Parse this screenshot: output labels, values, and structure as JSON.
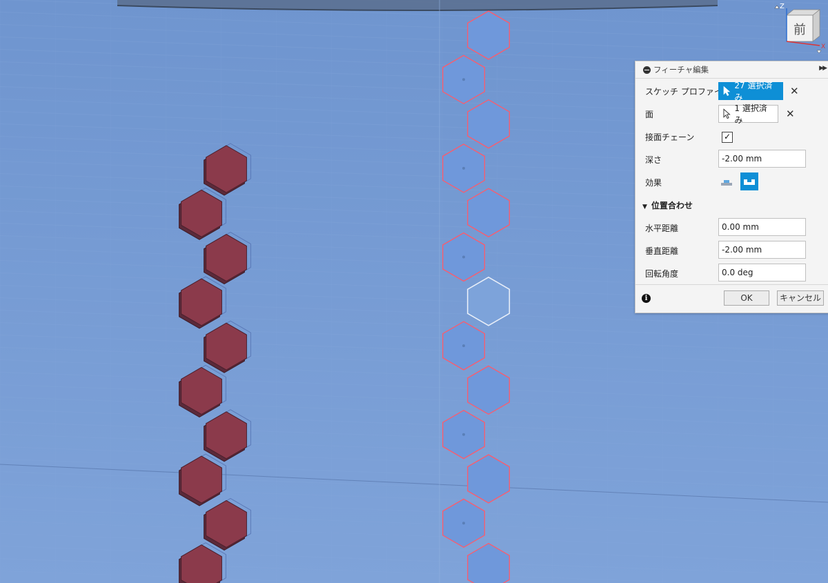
{
  "viewcube": {
    "face_label": "前",
    "axis_z": "Z",
    "axis_x": "X"
  },
  "panel": {
    "title": "フィーチャ編集",
    "rows": {
      "sketch_profile": {
        "label": "スケッチ プロファイル",
        "value": "27 選択済み"
      },
      "face": {
        "label": "面",
        "value": "1 選択済み"
      },
      "tangent_chain": {
        "label": "接面チェーン",
        "checked": true,
        "mark": "✓"
      },
      "depth": {
        "label": "深さ",
        "value": "-2.00 mm"
      },
      "effect": {
        "label": "効果"
      }
    },
    "alignment": {
      "group_label": "位置合わせ",
      "horizontal": {
        "label": "水平距離",
        "value": "0.00 mm"
      },
      "vertical": {
        "label": "垂直距離",
        "value": "-2.00 mm"
      },
      "rotation": {
        "label": "回転角度",
        "value": "0.0 deg"
      }
    },
    "ok_label": "OK",
    "cancel_label": "キャンセル",
    "info_glyph": "i"
  },
  "colors": {
    "viewport_bg": "#7a9fd6",
    "hex_fill_red": "#8b3a4b",
    "hex_outline_red": "#ff5a6a",
    "hex_outline_white": "#e8eef8",
    "accent": "#0e8fd6"
  }
}
